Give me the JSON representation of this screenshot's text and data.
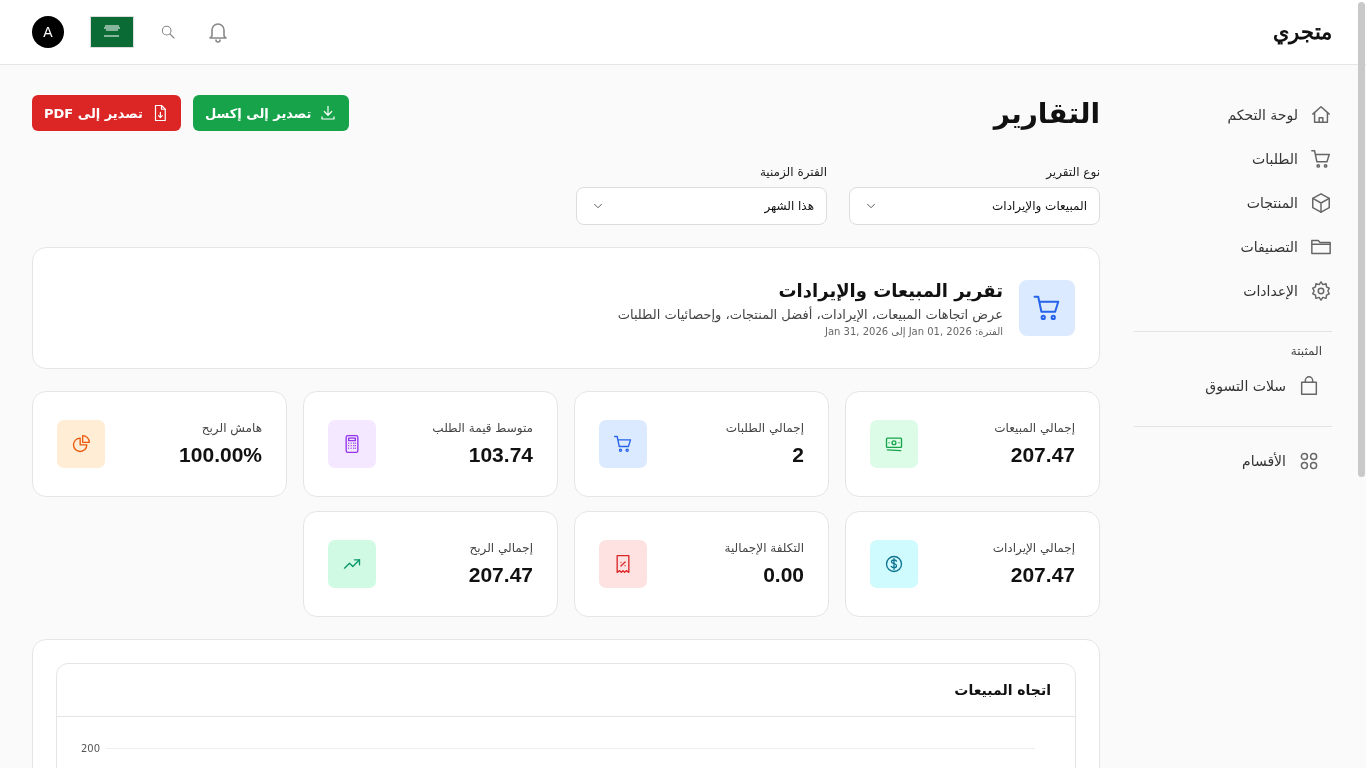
{
  "header": {
    "brand": "متجري",
    "avatar_initial": "A"
  },
  "sidebar": {
    "items": [
      {
        "label": "لوحة التحكم",
        "kind": "home"
      },
      {
        "label": "الطلبات",
        "kind": "cart"
      },
      {
        "label": "المنتجات",
        "kind": "box"
      },
      {
        "label": "التصنيفات",
        "kind": "folder"
      },
      {
        "label": "الإعدادات",
        "kind": "gear"
      }
    ],
    "pinned": {
      "title": "المثبتة",
      "items": [
        {
          "label": "سلات التسوق",
          "kind": "bag"
        }
      ]
    },
    "bottom_items": [
      {
        "label": "الأقسام",
        "kind": "grid"
      }
    ]
  },
  "page": {
    "title": "التقارير",
    "buttons": [
      {
        "label": "تصدير إلى إكسل",
        "kind": "excel"
      },
      {
        "label": "تصدير إلى PDF",
        "kind": "pdf"
      }
    ],
    "filters": [
      {
        "label": "نوع التقرير",
        "value": "المبيعات والإيرادات"
      },
      {
        "label": "الفترة الزمنية",
        "value": "هذا الشهر"
      }
    ],
    "report": {
      "title": "تقرير المبيعات والإيرادات",
      "description": "عرض اتجاهات المبيعات، الإيرادات، أفضل المنتجات، وإحصائيات الطلبات",
      "period": "الفترة: Jan 01, 2026 إلى Jan 31, 2026"
    },
    "stats": [
      {
        "label": "إجمالي المبيعات",
        "value": "207.47",
        "kind": "money"
      },
      {
        "label": "إجمالي الطلبات",
        "value": "2",
        "kind": "cart"
      },
      {
        "label": "متوسط قيمة الطلب",
        "value": "103.74",
        "kind": "calculator"
      },
      {
        "label": "هامش الربح",
        "value": "100.00%",
        "kind": "pie"
      },
      {
        "label": "إجمالي الإيرادات",
        "value": "207.47",
        "kind": "dollar"
      },
      {
        "label": "التكلفة الإجمالية",
        "value": "0.00",
        "kind": "receipt"
      },
      {
        "label": "إجمالي الربح",
        "value": "207.47",
        "kind": "trend"
      }
    ],
    "chart": {
      "title": "اتجاه المبيعات",
      "y_tick_labels": [
        "200"
      ]
    }
  }
}
